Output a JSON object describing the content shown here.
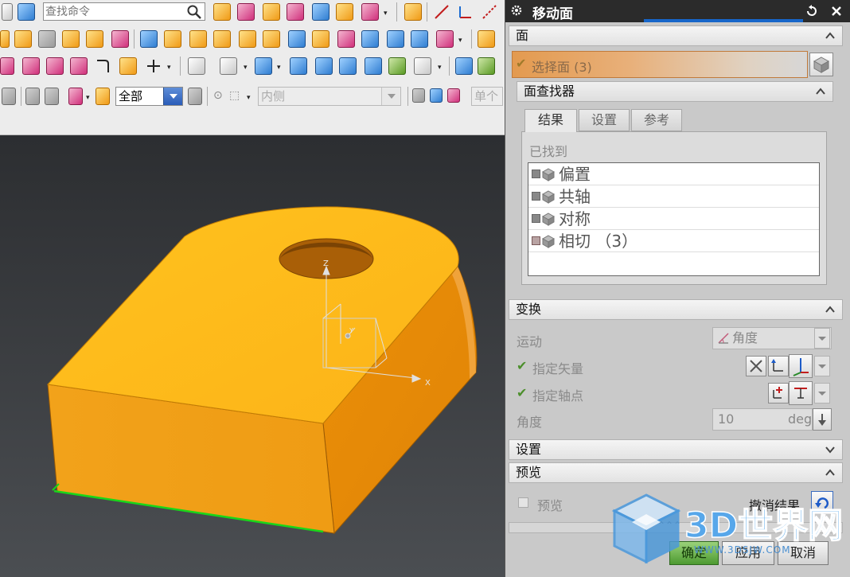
{
  "search": {
    "placeholder": "查找命令"
  },
  "toolbar": {
    "filter_value": "全部",
    "scope_value": "内侧",
    "single_value": "单个"
  },
  "viewport": {
    "axes": {
      "x": "X",
      "y": "Y",
      "z": "Z"
    },
    "colors": {
      "top_face": "#fdb81c",
      "side_face": "#e8900a",
      "edge_highlight": "#19d619"
    }
  },
  "dialog": {
    "title": "移动面",
    "face_section": {
      "header": "面",
      "select_label": "选择面 (3)"
    },
    "finder": {
      "header": "面查找器",
      "tabs": [
        "结果",
        "设置",
        "参考"
      ],
      "found_label": "已找到",
      "items": [
        {
          "label": "偏置",
          "checked": false
        },
        {
          "label": "共轴",
          "checked": false
        },
        {
          "label": "对称",
          "checked": false
        },
        {
          "label": "相切 （3）",
          "checked": true
        }
      ]
    },
    "transform": {
      "header": "变换",
      "motion_label": "运动",
      "motion_value": "角度",
      "vector_label": "指定矢量",
      "pivot_label": "指定轴点",
      "angle_label": "角度",
      "angle_value": "10",
      "angle_unit": "deg"
    },
    "settings": {
      "header": "设置"
    },
    "preview": {
      "header": "预览",
      "preview_label": "预览",
      "undo_label": "撤消结果"
    },
    "buttons": {
      "ok": "确定",
      "apply": "应用",
      "cancel": "取消"
    }
  },
  "watermark": {
    "text": "3D世界网",
    "url": "WWW.3DSJW.COM"
  }
}
